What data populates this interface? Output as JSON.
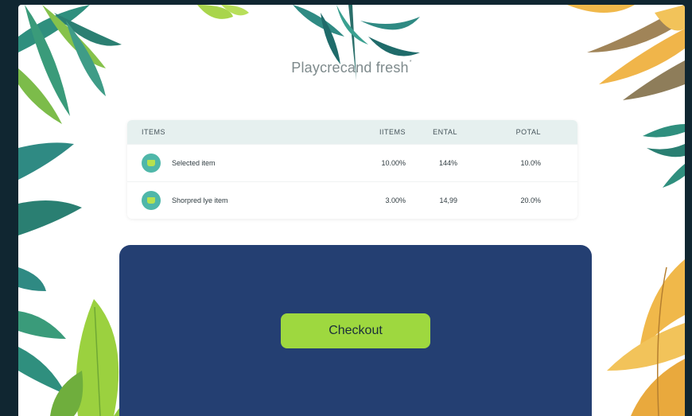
{
  "brand": {
    "name": "Playcrecand fresh",
    "mark": "*"
  },
  "table": {
    "headers": [
      "ITEMS",
      "IITEMS",
      "ENTAL",
      "POTAL"
    ],
    "rows": [
      {
        "name": "Selected item",
        "col2": "10.00%",
        "col3": "144%",
        "col4": "10.0%"
      },
      {
        "name": "Shorpred lye item",
        "col2": "3.00%",
        "col3": "14,99",
        "col4": "20.0%"
      }
    ]
  },
  "checkout": {
    "label": "Checkout"
  },
  "colors": {
    "frame": "#102631",
    "panel": "#243f72",
    "accent_green": "#9ed83f",
    "table_header": "#e6f0ef",
    "thumb": "#4fb7a9"
  }
}
